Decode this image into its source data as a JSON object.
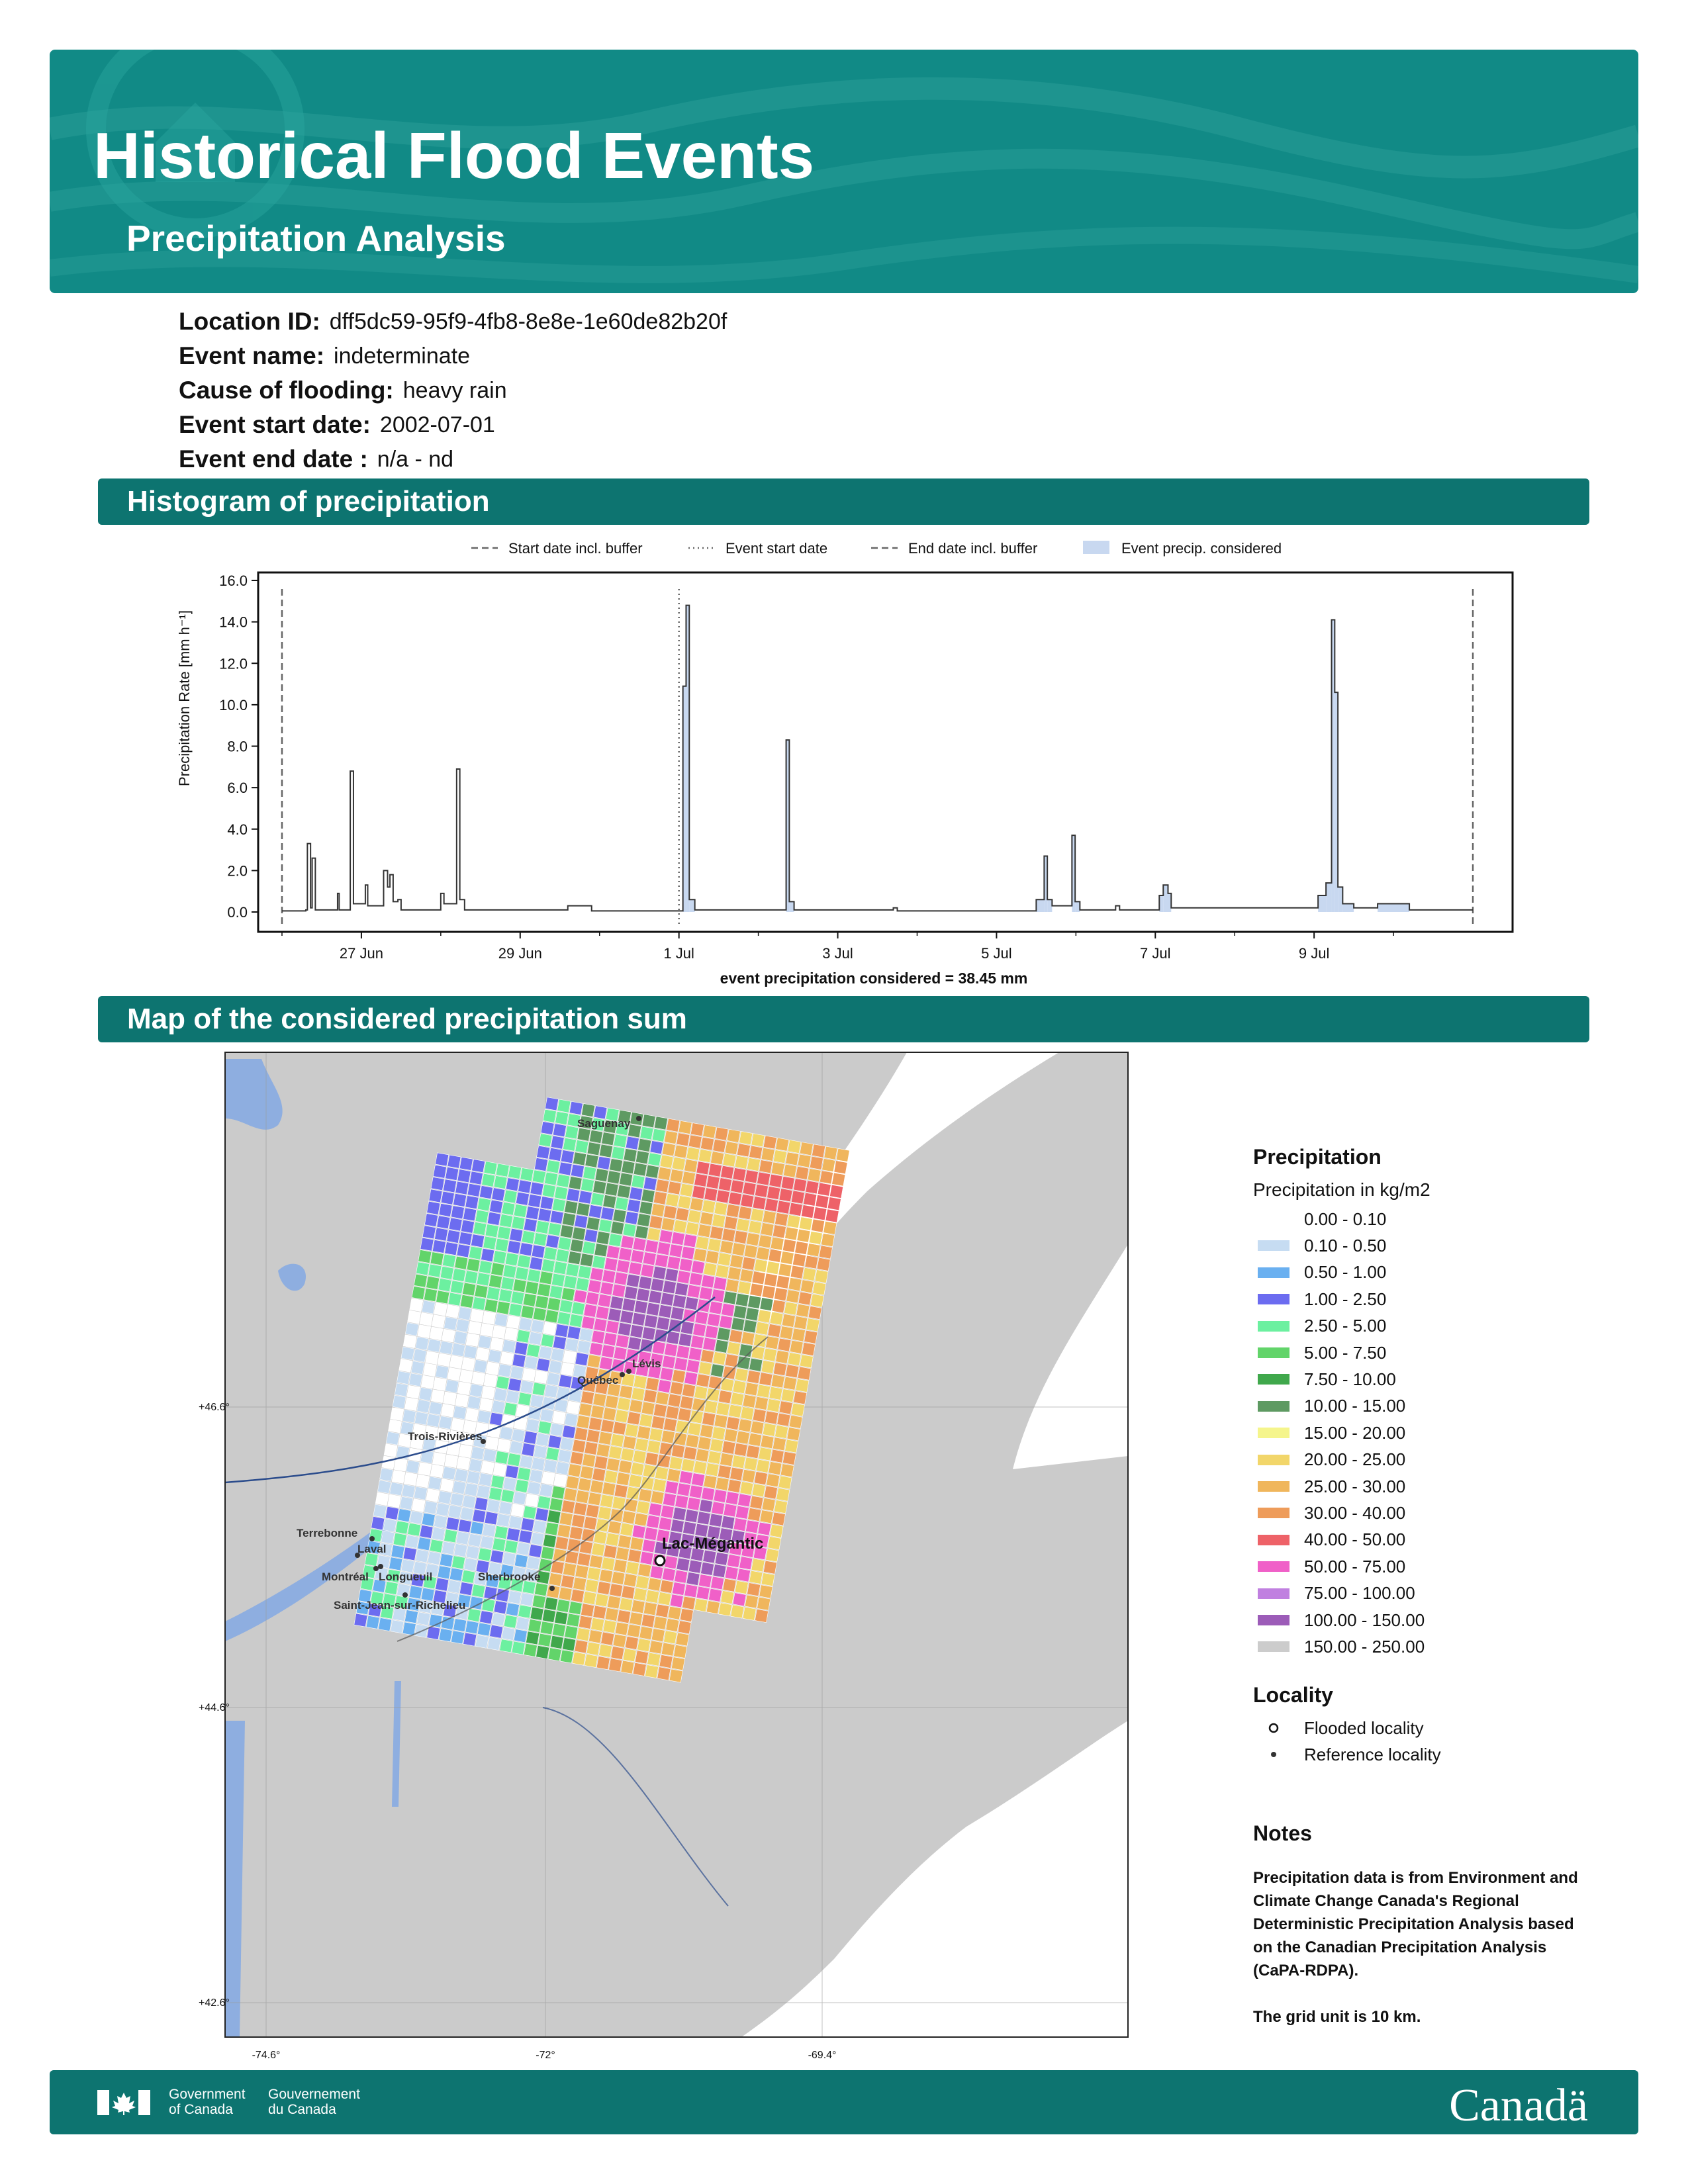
{
  "header": {
    "title": "Historical Flood Events",
    "subtitle": "Precipitation Analysis"
  },
  "event_info": [
    {
      "label": "Location ID:",
      "value": "dff5dc59-95f9-4fb8-8e8e-1e60de82b20f"
    },
    {
      "label": "Event name:",
      "value": "indeterminate"
    },
    {
      "label": "Cause of flooding:",
      "value": "heavy rain"
    },
    {
      "label": "Event start date:",
      "value": "2002-07-01"
    },
    {
      "label": "Event end date :",
      "value": "n/a - nd"
    }
  ],
  "sections": {
    "histogram": "Histogram of precipitation",
    "map": "Map of the considered precipitation sum"
  },
  "chart_data": {
    "type": "line",
    "ylabel": "Precipitation Rate [mm h⁻¹]",
    "xlabel": "event precipitation considered = 38.45 mm",
    "ylim": [
      0,
      16
    ],
    "yticks": [
      "0.0",
      "2.0",
      "4.0",
      "6.0",
      "8.0",
      "10.0",
      "12.0",
      "14.0",
      "16.0"
    ],
    "xlim": [
      25.7,
      41.5
    ],
    "xticks": [
      {
        "day": 27,
        "label": "27 Jun"
      },
      {
        "day": 29,
        "label": "29 Jun"
      },
      {
        "day": 31,
        "label": "1 Jul"
      },
      {
        "day": 33,
        "label": "3 Jul"
      },
      {
        "day": 35,
        "label": "5 Jul"
      },
      {
        "day": 37,
        "label": "7 Jul"
      },
      {
        "day": 39,
        "label": "9 Jul"
      }
    ],
    "legend": [
      "Start date incl. buffer",
      "Event start date",
      "End date incl. buffer",
      "Event precip. considered"
    ],
    "start_buffer": 26,
    "event_start": 31,
    "end_buffer": 41,
    "series": [
      {
        "values": [
          [
            26.0,
            0.05
          ],
          [
            26.3,
            0.1
          ],
          [
            26.32,
            3.3
          ],
          [
            26.36,
            0.2
          ],
          [
            26.38,
            2.6
          ],
          [
            26.42,
            0.1
          ],
          [
            26.7,
            0.9
          ],
          [
            26.72,
            0.1
          ],
          [
            26.86,
            6.8
          ],
          [
            26.9,
            0.4
          ],
          [
            27.05,
            1.3
          ],
          [
            27.08,
            0.3
          ],
          [
            27.28,
            2.0
          ],
          [
            27.33,
            1.2
          ],
          [
            27.36,
            1.8
          ],
          [
            27.4,
            0.5
          ],
          [
            27.46,
            0.6
          ],
          [
            27.5,
            0.1
          ],
          [
            28.0,
            0.9
          ],
          [
            28.04,
            0.4
          ],
          [
            28.2,
            6.9
          ],
          [
            28.24,
            0.6
          ],
          [
            28.3,
            0.1
          ],
          [
            29.6,
            0.3
          ],
          [
            29.88,
            0.3
          ],
          [
            29.9,
            0.05
          ],
          [
            31.05,
            10.9
          ],
          [
            31.09,
            14.8
          ],
          [
            31.13,
            0.6
          ],
          [
            31.2,
            0.1
          ],
          [
            32.35,
            8.3
          ],
          [
            32.39,
            0.5
          ],
          [
            32.45,
            0.1
          ],
          [
            33.7,
            0.2
          ],
          [
            33.75,
            0.05
          ],
          [
            35.5,
            0.6
          ],
          [
            35.6,
            2.7
          ],
          [
            35.64,
            0.6
          ],
          [
            35.7,
            0.3
          ],
          [
            35.95,
            3.7
          ],
          [
            35.99,
            0.5
          ],
          [
            36.05,
            0.1
          ],
          [
            36.5,
            0.3
          ],
          [
            36.55,
            0.1
          ],
          [
            37.05,
            0.8
          ],
          [
            37.1,
            1.3
          ],
          [
            37.16,
            0.9
          ],
          [
            37.2,
            0.2
          ],
          [
            38.2,
            0.2
          ],
          [
            39.05,
            0.8
          ],
          [
            39.15,
            1.4
          ],
          [
            39.22,
            14.1
          ],
          [
            39.26,
            10.6
          ],
          [
            39.3,
            1.2
          ],
          [
            39.36,
            0.4
          ],
          [
            39.5,
            0.2
          ],
          [
            39.8,
            0.4
          ],
          [
            40.2,
            0.1
          ],
          [
            41.0,
            0.1
          ]
        ]
      }
    ]
  },
  "map": {
    "lat_labels": [
      "+46.6°",
      "+44.6°",
      "+42.6°"
    ],
    "lon_labels": [
      "-74.6°",
      "-72°",
      "-69.4°"
    ],
    "flooded_locality": "Lac-Mégantic",
    "reference_localities": [
      "Saguenay",
      "Lévis",
      "Québec",
      "Trois-Rivières",
      "Terrebonne",
      "Laval",
      "Montréal",
      "Longueuil",
      "Sherbrooke",
      "Saint-Jean-sur-Richelieu"
    ]
  },
  "map_legend": {
    "title": "Precipitation",
    "subtitle": "Precipitation in kg/m2",
    "classes": [
      {
        "label": "0.00 - 0.10",
        "color": "#ffffff"
      },
      {
        "label": "0.10 - 0.50",
        "color": "#c6dcf2"
      },
      {
        "label": "0.50 - 1.00",
        "color": "#6ab0f0"
      },
      {
        "label": "1.00 - 2.50",
        "color": "#6c6cf0"
      },
      {
        "label": "2.50 - 5.00",
        "color": "#6cf0a0"
      },
      {
        "label": "5.00 - 7.50",
        "color": "#62d46a"
      },
      {
        "label": "7.50 - 10.00",
        "color": "#40a84c"
      },
      {
        "label": "10.00 - 15.00",
        "color": "#5e9a62"
      },
      {
        "label": "15.00 - 20.00",
        "color": "#f5f58c"
      },
      {
        "label": "20.00 - 25.00",
        "color": "#f2d66a"
      },
      {
        "label": "25.00 - 30.00",
        "color": "#f0b65c"
      },
      {
        "label": "30.00 - 40.00",
        "color": "#ee9c5a"
      },
      {
        "label": "40.00 - 50.00",
        "color": "#ee6268"
      },
      {
        "label": "50.00 - 75.00",
        "color": "#f060c8"
      },
      {
        "label": "75.00 - 100.00",
        "color": "#c080e0"
      },
      {
        "label": "100.00 - 150.00",
        "color": "#9c5cb8"
      },
      {
        "label": "150.00 - 250.00",
        "color": "#cccccc"
      }
    ],
    "locality_title": "Locality",
    "flooded_label": "Flooded locality",
    "reference_label": "Reference locality"
  },
  "notes": {
    "title": "Notes",
    "text": "Precipitation data is from Environment and Climate Change Canada's Regional Deterministic Precipitation Analysis based on the Canadian Precipitation Analysis (CaPA-RDPA).",
    "grid": "The grid unit is 10 km."
  },
  "footer": {
    "gov_en_1": "Government",
    "gov_en_2": "of Canada",
    "gov_fr_1": "Gouvernement",
    "gov_fr_2": "du Canada",
    "wordmark": "Canadä"
  }
}
